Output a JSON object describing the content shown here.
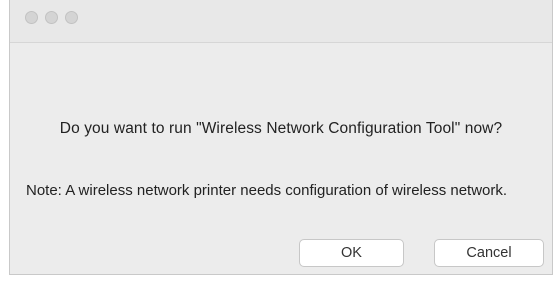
{
  "dialog": {
    "question": "Do you want to run \"Wireless Network Configuration Tool\" now?",
    "note": "Note: A wireless network printer needs configuration of wireless network.",
    "buttons": {
      "ok_label": "OK",
      "cancel_label": "Cancel"
    }
  },
  "titlebar": {
    "buttons": [
      "close-icon",
      "minimize-icon",
      "zoom-icon"
    ]
  },
  "colors": {
    "window_background": "#ececec",
    "button_background": "#ffffff",
    "text": "#222222"
  }
}
